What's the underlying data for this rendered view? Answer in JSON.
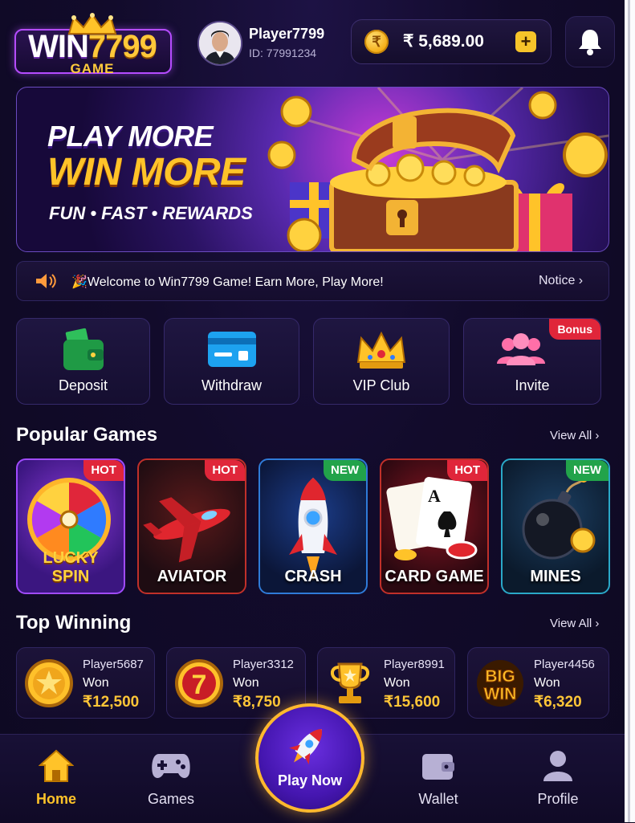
{
  "brand": {
    "logo_main": "WIN",
    "logo_num": "7799",
    "logo_sub": "GAME"
  },
  "player": {
    "name": "Player7799",
    "id": "ID: 77991234"
  },
  "balance": {
    "currency": "₹",
    "value": "₹ 5,689.00",
    "add_label": "+"
  },
  "banner": {
    "line1": "PLAY MORE",
    "line2": "WIN MORE",
    "line3": "FUN • FAST • REWARDS"
  },
  "notice": {
    "text": "🎉Welcome to Win7799 Game! Earn More, Play More!",
    "button": "Notice ›"
  },
  "quick_actions": [
    {
      "label": "Deposit",
      "icon": "wallet-icon"
    },
    {
      "label": "Withdraw",
      "icon": "card-icon"
    },
    {
      "label": "VIP Club",
      "icon": "crown-icon"
    },
    {
      "label": "Invite",
      "icon": "users-icon",
      "badge": "Bonus"
    }
  ],
  "popular": {
    "title": "Popular Games",
    "view_all": "View All ›",
    "games": [
      {
        "name_line1": "LUCKY",
        "name_line2": "SPIN",
        "badge": "HOT"
      },
      {
        "name": "AVIATOR",
        "badge": "HOT"
      },
      {
        "name": "CRASH",
        "badge": "NEW"
      },
      {
        "name": "CARD GAME",
        "badge": "HOT"
      },
      {
        "name": "MINES",
        "badge": "NEW"
      }
    ]
  },
  "top_winning": {
    "title": "Top Winning",
    "view_all": "View All ›",
    "winners": [
      {
        "player": "Player5687",
        "won_label": "Won",
        "amount": "₹12,500",
        "icon": "star-coin-icon"
      },
      {
        "player": "Player3312",
        "won_label": "Won",
        "amount": "₹8,750",
        "icon": "slot-seven-icon"
      },
      {
        "player": "Player8991",
        "won_label": "Won",
        "amount": "₹15,600",
        "icon": "trophy-icon"
      },
      {
        "player": "Player4456",
        "won_label": "Won",
        "amount": "₹6,320",
        "icon": "big-win-icon",
        "icon_text_1": "BIG",
        "icon_text_2": "WIN"
      }
    ]
  },
  "nav": {
    "home": "Home",
    "games": "Games",
    "play": "Play Now",
    "wallet": "Wallet",
    "profile": "Profile",
    "active": "home"
  },
  "colors": {
    "accent_gold": "#ffc329",
    "hot": "#e0263a",
    "new": "#22a34a",
    "bg": "#120b2b"
  }
}
